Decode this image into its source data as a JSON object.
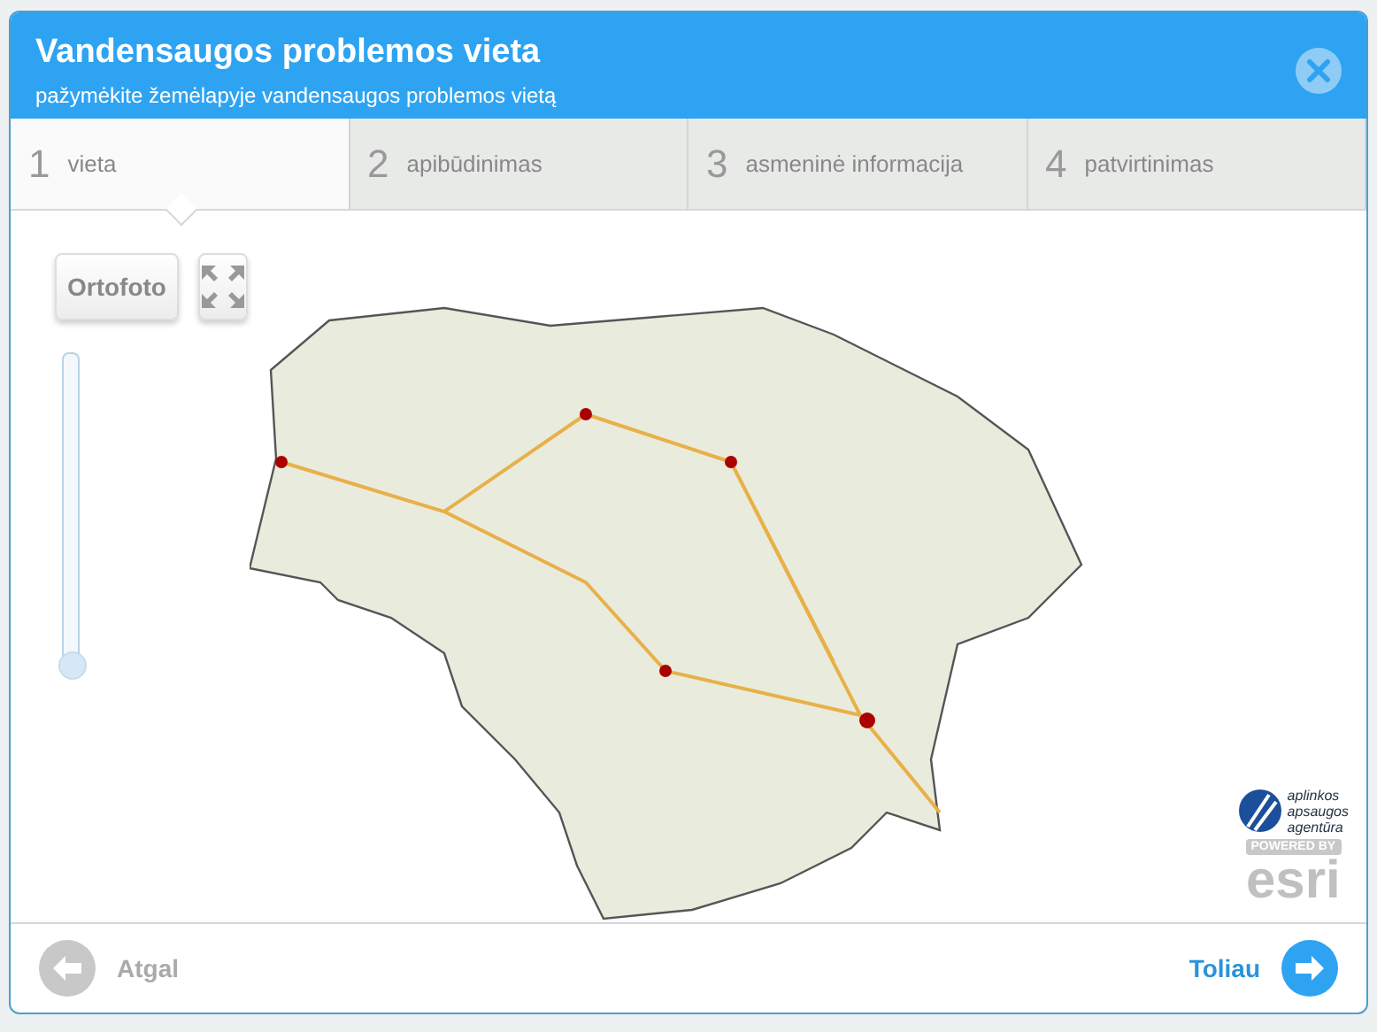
{
  "dialog": {
    "title": "Vandensaugos problemos vieta",
    "subtitle": "pažymėkite žemėlapyje vandensaugos problemos vietą"
  },
  "steps": [
    {
      "number": "1",
      "label": "vieta",
      "selected": true
    },
    {
      "number": "2",
      "label": "apibūdinimas",
      "selected": false
    },
    {
      "number": "3",
      "label": "asmeninė informacija",
      "selected": false
    },
    {
      "number": "4",
      "label": "patvirtinimas",
      "selected": false
    }
  ],
  "map": {
    "basemap_button": "Ortofoto",
    "zoom": {
      "level": 0
    },
    "logo": {
      "agency": [
        "aplinkos",
        "apsaugos",
        "agentūra"
      ],
      "powered_by": "POWERED BY",
      "brand": "esri"
    }
  },
  "footer": {
    "back": {
      "label": "Atgal",
      "disabled": true
    },
    "next": {
      "label": "Toliau",
      "disabled": false
    }
  }
}
